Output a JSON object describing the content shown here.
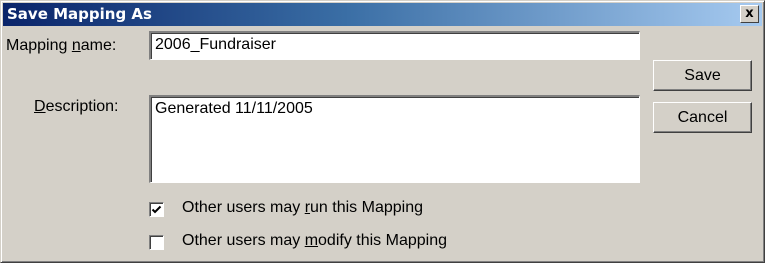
{
  "window": {
    "title": "Save Mapping As",
    "close_glyph": "x"
  },
  "form": {
    "name_label_pre": "Mapping ",
    "name_label_key": "n",
    "name_label_post": "ame:",
    "name_value": "2006_Fundraiser",
    "desc_label_pre": "",
    "desc_label_key": "D",
    "desc_label_post": "escription:",
    "desc_value": "Generated 11/11/2005"
  },
  "buttons": {
    "save": "Save",
    "cancel": "Cancel"
  },
  "options": {
    "run": {
      "checked": true,
      "pre": "Other users may ",
      "key": "r",
      "post": "un this Mapping"
    },
    "modify": {
      "checked": false,
      "pre": "Other users may ",
      "key": "m",
      "post": "odify this Mapping"
    }
  },
  "icons": {
    "close": "close-icon",
    "check": "checkmark-icon"
  }
}
